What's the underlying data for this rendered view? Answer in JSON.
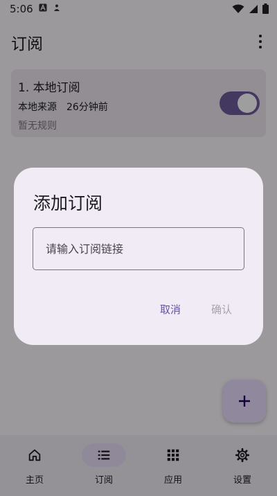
{
  "status_bar": {
    "time": "5:06"
  },
  "top_bar": {
    "title": "订阅"
  },
  "subscription": {
    "name": "1. 本地订阅",
    "source": "本地来源",
    "updated": "26分钟前",
    "rules": "暂无规则",
    "enabled": true
  },
  "bottom_nav": {
    "items": [
      {
        "label": "主页",
        "icon": "home-icon"
      },
      {
        "label": "订阅",
        "icon": "list-icon",
        "active": true
      },
      {
        "label": "应用",
        "icon": "apps-grid-icon"
      },
      {
        "label": "设置",
        "icon": "gear-icon"
      }
    ]
  },
  "dialog": {
    "title": "添加订阅",
    "input_placeholder": "请输入订阅链接",
    "input_value": "",
    "cancel_label": "取消",
    "confirm_label": "确认"
  },
  "colors": {
    "accent": "#6750a4",
    "toggle_track": "#6c5b9b",
    "fab_bg": "#e9ddff",
    "dialog_bg": "#f0ebf4",
    "disabled_text": "#a8a4ab"
  }
}
